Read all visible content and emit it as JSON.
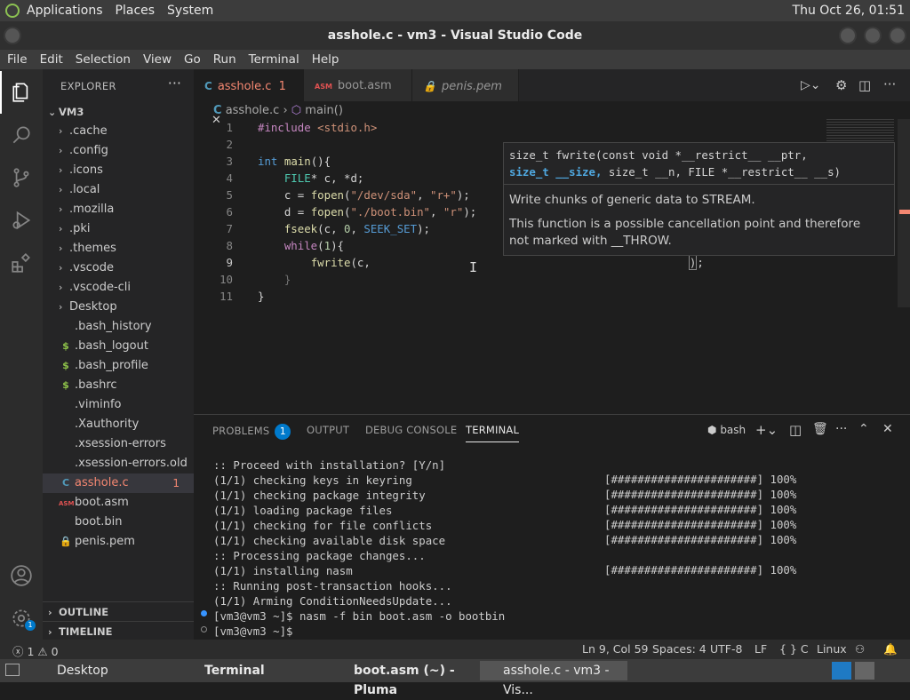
{
  "top_panel": {
    "items": [
      "Applications",
      "Places",
      "System"
    ],
    "clock": "Thu Oct 26, 01:51"
  },
  "window": {
    "title": "asshole.c - vm3 - Visual Studio Code"
  },
  "menu": {
    "items": [
      "File",
      "Edit",
      "Selection",
      "View",
      "Go",
      "Run",
      "Terminal",
      "Help"
    ]
  },
  "sidebar": {
    "header": "EXPLORER",
    "root": "VM3",
    "items": [
      {
        "label": ".cache",
        "kind": "folder"
      },
      {
        "label": ".config",
        "kind": "folder"
      },
      {
        "label": ".icons",
        "kind": "folder"
      },
      {
        "label": ".local",
        "kind": "folder"
      },
      {
        "label": ".mozilla",
        "kind": "folder"
      },
      {
        "label": ".pki",
        "kind": "folder"
      },
      {
        "label": ".themes",
        "kind": "folder"
      },
      {
        "label": ".vscode",
        "kind": "folder"
      },
      {
        "label": ".vscode-cli",
        "kind": "folder"
      },
      {
        "label": "Desktop",
        "kind": "folder"
      },
      {
        "label": ".bash_history",
        "kind": "file"
      },
      {
        "label": ".bash_logout",
        "kind": "shell"
      },
      {
        "label": ".bash_profile",
        "kind": "shell"
      },
      {
        "label": ".bashrc",
        "kind": "shell"
      },
      {
        "label": ".viminfo",
        "kind": "file"
      },
      {
        "label": ".Xauthority",
        "kind": "file"
      },
      {
        "label": ".xsession-errors",
        "kind": "file"
      },
      {
        "label": ".xsession-errors.old",
        "kind": "file"
      },
      {
        "label": "asshole.c",
        "kind": "c",
        "badge": "1",
        "active": true
      },
      {
        "label": "boot.asm",
        "kind": "asm"
      },
      {
        "label": "boot.bin",
        "kind": "file"
      },
      {
        "label": "penis.pem",
        "kind": "pem"
      }
    ],
    "outline_label": "OUTLINE",
    "timeline_label": "TIMELINE",
    "icons": {
      "c": "C",
      "asm": "ASM",
      "shell": "$",
      "pem": "lock-icon"
    }
  },
  "tabs": [
    {
      "label": "asshole.c",
      "badge": "1",
      "icon": "C",
      "active": true
    },
    {
      "label": "boot.asm",
      "icon": "ASM"
    },
    {
      "label": "penis.pem",
      "icon": "lock-icon"
    }
  ],
  "breadcrumb": {
    "file": "asshole.c",
    "symbol": "main()"
  },
  "code": {
    "line_numbers": [
      "1",
      "2",
      "3",
      "4",
      "5",
      "6",
      "7",
      "8",
      "9",
      "10",
      "11"
    ]
  },
  "hover": {
    "sig_line1": "size_t fwrite(const void *__restrict__ __ptr,",
    "sig_line2_highlight": "size_t __size,",
    "sig_line2_rest": " size_t __n, FILE *__restrict__ __s)",
    "doc1": "Write chunks of generic data to STREAM.",
    "doc2": "This function is a possible cancellation point and therefore not marked with __THROW."
  },
  "panel": {
    "tabs": [
      "PROBLEMS",
      "OUTPUT",
      "DEBUG CONSOLE",
      "TERMINAL"
    ],
    "problems_count": "1",
    "shell": "bash",
    "terminal_lines": [
      ":: Proceed with installation? [Y/n]",
      "(1/1) checking keys in keyring",
      "(1/1) checking package integrity",
      "(1/1) loading package files",
      "(1/1) checking for file conflicts",
      "(1/1) checking available disk space",
      ":: Processing package changes...",
      "(1/1) installing nasm",
      ":: Running post-transaction hooks...",
      "(1/1) Arming ConditionNeedsUpdate...",
      "[vm3@vm3 ~]$ nasm -f bin boot.asm -o bootbin",
      "[vm3@vm3 ~]$ "
    ],
    "progress_bar": "[######################] 100%"
  },
  "status": {
    "problems": "ⓧ 1 ⚠ 0",
    "position": "Ln 9, Col 59",
    "spaces": "Spaces: 4",
    "encoding": "UTF-8",
    "eol": "LF",
    "language": "{ } C",
    "platform": "Linux"
  },
  "taskbar": {
    "items": [
      "Desktop",
      "Terminal",
      "boot.asm (~) - Pluma",
      "asshole.c - vm3 - Vis..."
    ]
  }
}
